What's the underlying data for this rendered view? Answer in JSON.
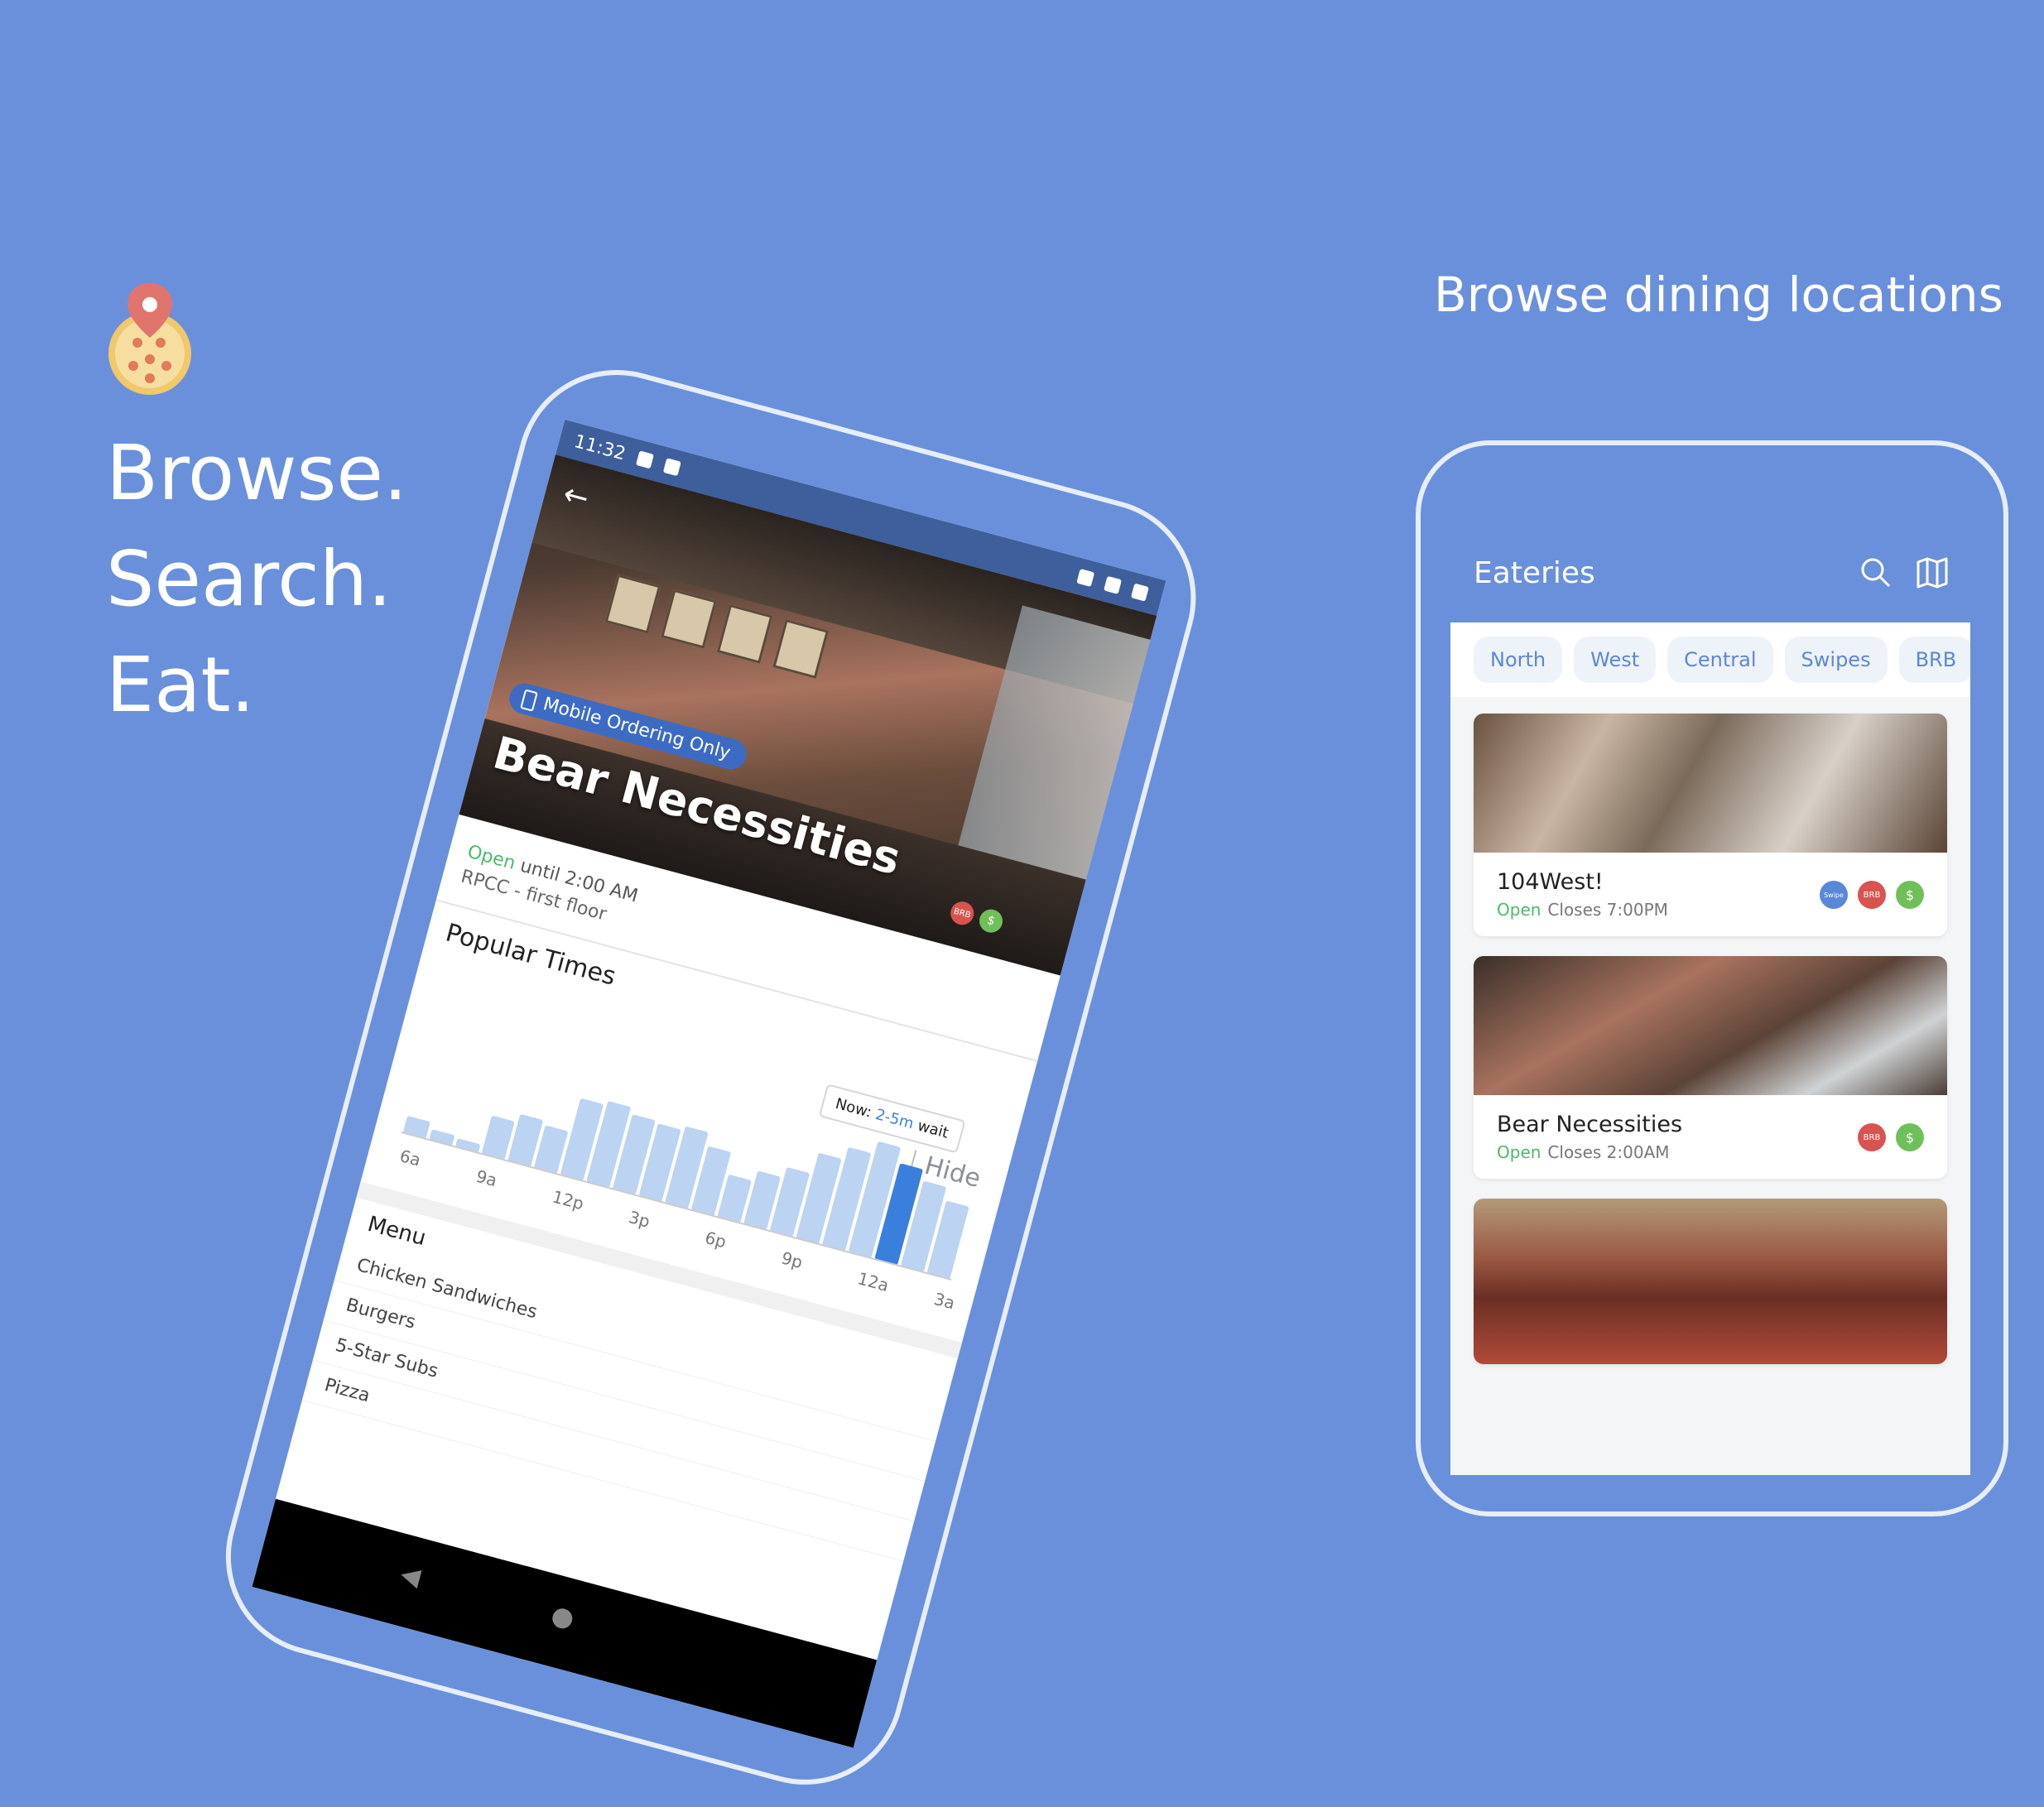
{
  "colors": {
    "background": "#6a90dc",
    "accent": "#3b7fdc",
    "open_green": "#4cb96a",
    "brb_red": "#d9534f",
    "dollar_green": "#6fc05a",
    "swipe_blue": "#5b88d6"
  },
  "tagline": {
    "line1": "Browse.",
    "line2": "Search.",
    "line3": "Eat."
  },
  "headline": "Browse dining locations",
  "detail": {
    "status_time": "11:32",
    "badge_mobile": "Mobile Ordering Only",
    "name": "Bear Necessities",
    "open_label": "Open",
    "open_until": "until 2:00 AM",
    "location": "RPCC - first floor",
    "badges": [
      "BRB",
      "$"
    ],
    "popular_title": "Popular Times",
    "hide_label": "Hide",
    "tooltip_prefix": "Now:",
    "tooltip_wait": "2-5m",
    "tooltip_suffix": "wait",
    "menu_title": "Menu",
    "menu_items": [
      "Chicken Sandwiches",
      "Burgers",
      "5-Star Subs",
      "Pizza"
    ]
  },
  "chart_data": {
    "type": "bar",
    "title": "Popular Times",
    "x_tick_labels": [
      "6a",
      "9a",
      "12p",
      "3p",
      "6p",
      "9p",
      "12a",
      "3a"
    ],
    "values": [
      8,
      5,
      4,
      18,
      22,
      20,
      36,
      38,
      35,
      34,
      36,
      30,
      20,
      25,
      30,
      40,
      46,
      52,
      45,
      40,
      34
    ],
    "highlight_index": 18,
    "ylim": [
      0,
      60
    ],
    "grid": false
  },
  "list_screen": {
    "title": "Eateries",
    "icons": [
      "search-icon",
      "map-icon"
    ],
    "filters": [
      "North",
      "West",
      "Central",
      "Swipes",
      "BRB"
    ],
    "cards": [
      {
        "name": "104West!",
        "open_label": "Open",
        "closes": "Closes 7:00PM",
        "badges": [
          "Swipe",
          "BRB",
          "$"
        ]
      },
      {
        "name": "Bear Necessities",
        "open_label": "Open",
        "closes": "Closes 2:00AM",
        "badges": [
          "BRB",
          "$"
        ]
      },
      {
        "name": "",
        "open_label": "",
        "closes": "",
        "badges": []
      }
    ]
  }
}
